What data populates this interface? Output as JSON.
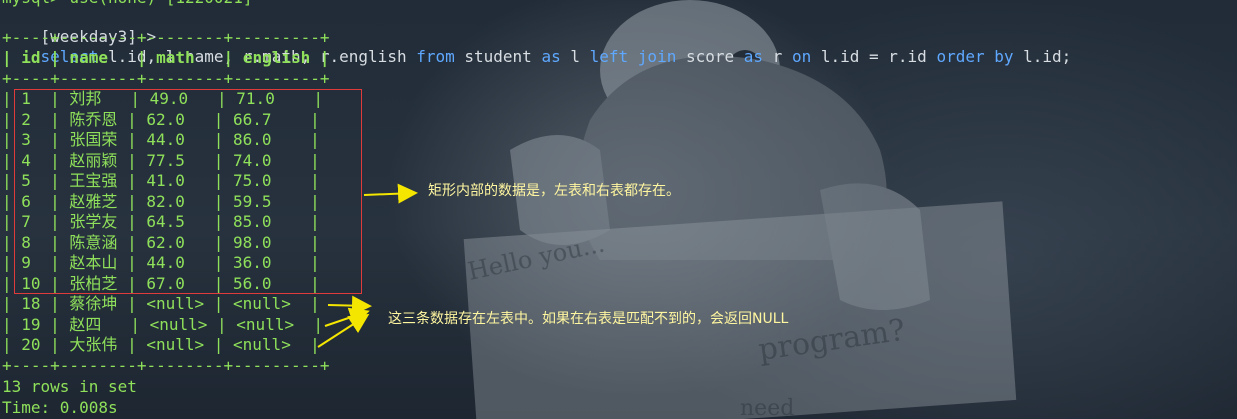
{
  "prev_line": "mysql> use(none) [1220021]",
  "prompt": "[weekday3] >",
  "sql": {
    "select": "select",
    "cols": " l.id, l.name, r.math, r.english ",
    "from": "from",
    "t1": " student ",
    "as1": "as",
    "a1": " l ",
    "left": "left",
    "sp1": " ",
    "join": "join",
    "t2": " score ",
    "as2": "as",
    "a2": " r ",
    "on": "on",
    "cond": " l.id = r.id ",
    "order": "order",
    "sp2": " ",
    "by": "by",
    "tail": " l.id;"
  },
  "table": {
    "border": "+----+--------+--------+---------+",
    "headers": [
      "id",
      "name",
      "math",
      "english"
    ],
    "rows": [
      [
        "1",
        "刘邦",
        "49.0",
        "71.0"
      ],
      [
        "2",
        "陈乔恩",
        "62.0",
        "66.7"
      ],
      [
        "3",
        "张国荣",
        "44.0",
        "86.0"
      ],
      [
        "4",
        "赵丽颖",
        "77.5",
        "74.0"
      ],
      [
        "5",
        "王宝强",
        "41.0",
        "75.0"
      ],
      [
        "6",
        "赵雅芝",
        "82.0",
        "59.5"
      ],
      [
        "7",
        "张学友",
        "64.5",
        "85.0"
      ],
      [
        "8",
        "陈意涵",
        "62.0",
        "98.0"
      ],
      [
        "9",
        "赵本山",
        "44.0",
        "36.0"
      ],
      [
        "10",
        "张柏芝",
        "67.0",
        "56.0"
      ],
      [
        "18",
        "蔡徐坤",
        "<null>",
        "<null>"
      ],
      [
        "19",
        "赵四",
        "<null>",
        "<null>"
      ],
      [
        "20",
        "大张伟",
        "<null>",
        "<null>"
      ]
    ]
  },
  "summary": "13 rows in set",
  "time": "Time: 0.008s",
  "annotations": {
    "inner": "矩形内部的数据是，左表和右表都存在。",
    "outer": "这三条数据存在左表中。如果在右表是匹配不到的，会返回NULL"
  },
  "colors": {
    "keyword": "#5fa8ff",
    "table_text": "#8fe05a",
    "rect": "#e03b3b",
    "annotation": "#fff6a0",
    "arrow": "#f5e600"
  }
}
